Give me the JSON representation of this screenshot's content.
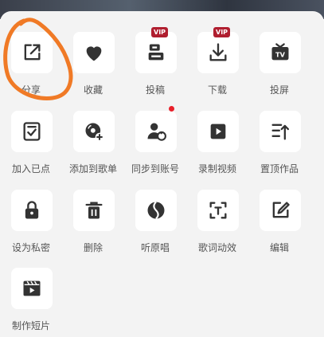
{
  "menu": {
    "items": [
      {
        "label": "分享",
        "icon": "share-icon"
      },
      {
        "label": "收藏",
        "icon": "heart-icon"
      },
      {
        "label": "投稿",
        "icon": "submit-icon",
        "badge": "VIP"
      },
      {
        "label": "下载",
        "icon": "download-icon",
        "badge": "VIP"
      },
      {
        "label": "投屏",
        "icon": "tv-cast-icon"
      },
      {
        "label": "加入已点",
        "icon": "checklist-icon"
      },
      {
        "label": "添加到歌单",
        "icon": "add-to-playlist-icon"
      },
      {
        "label": "同步到账号",
        "icon": "sync-account-icon"
      },
      {
        "label": "录制视频",
        "icon": "record-video-icon"
      },
      {
        "label": "置顶作品",
        "icon": "pin-top-icon"
      },
      {
        "label": "设为私密",
        "icon": "lock-icon"
      },
      {
        "label": "删除",
        "icon": "trash-icon"
      },
      {
        "label": "听原唱",
        "icon": "original-vocal-icon"
      },
      {
        "label": "歌词动效",
        "icon": "lyric-effect-icon"
      },
      {
        "label": "编辑",
        "icon": "edit-icon"
      },
      {
        "label": "制作短片",
        "icon": "clapper-icon"
      }
    ]
  },
  "colors": {
    "sheet_bg": "#f3f3f3",
    "tile_bg": "#ffffff",
    "icon": "#333333",
    "label": "#555555",
    "vip_badge": "#b01e2f",
    "notify_dot": "#e8202a",
    "annotation_circle": "#f07a26"
  }
}
